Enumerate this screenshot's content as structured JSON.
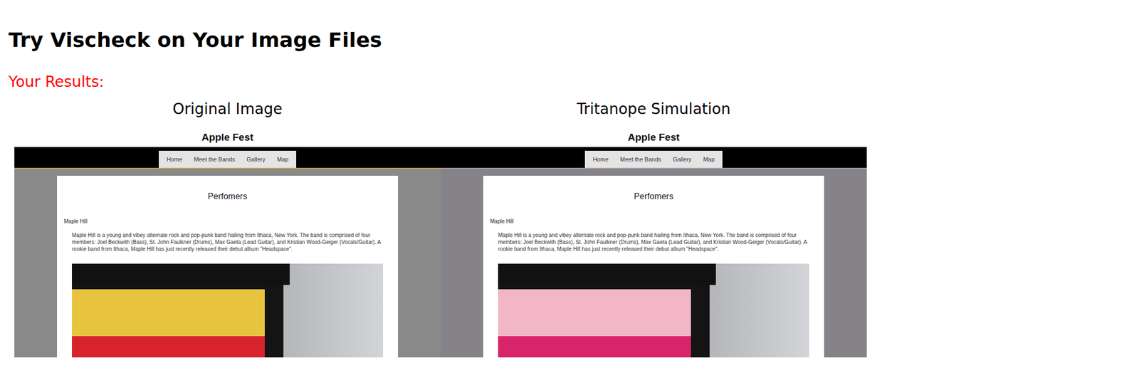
{
  "page": {
    "title": "Try Vischeck on Your Image Files",
    "results_label": "Your Results:"
  },
  "panels": [
    {
      "caption": "Original Image",
      "site": {
        "title": "Apple Fest",
        "nav": [
          "Home",
          "Meet the Bands",
          "Gallery",
          "Map"
        ],
        "heading": "Perfomers",
        "band": "Maple Hill",
        "description": "Maple Hill is a young and vibey alternate rock and pop-punk band hailing from Ithaca, New York. The band is comprised of four members: Joel Beckwith (Bass), St. John Faulkner (Drums), Max Gaeta (Lead Guitar), and Kristian Wood-Geiger (Vocals/Guitar). A rookie band from Ithaca, Maple Hill has just recently released their debut album \"Headspace\"."
      },
      "colors": {
        "accent": "#c8a43a",
        "ground": "#898989",
        "paint_top": "#e8c43e",
        "paint_bottom": "#d8232c"
      }
    },
    {
      "caption": "Tritanope Simulation",
      "site": {
        "title": "Apple Fest",
        "nav": [
          "Home",
          "Meet the Bands",
          "Gallery",
          "Map"
        ],
        "heading": "Perfomers",
        "band": "Maple Hill",
        "description": "Maple Hill is a young and vibey alternate rock and pop-punk band hailing from Ithaca, New York. The band is comprised of four members: Joel Beckwith (Bass), St. John Faulkner (Drums), Max Gaeta (Lead Guitar), and Kristian Wood-Geiger (Vocals/Guitar). A rookie band from Ithaca, Maple Hill has just recently released their debut album \"Headspace\"."
      },
      "colors": {
        "accent": "#a99ea2",
        "ground": "#858388",
        "paint_top": "#f2b6c6",
        "paint_bottom": "#d8246a"
      }
    }
  ]
}
